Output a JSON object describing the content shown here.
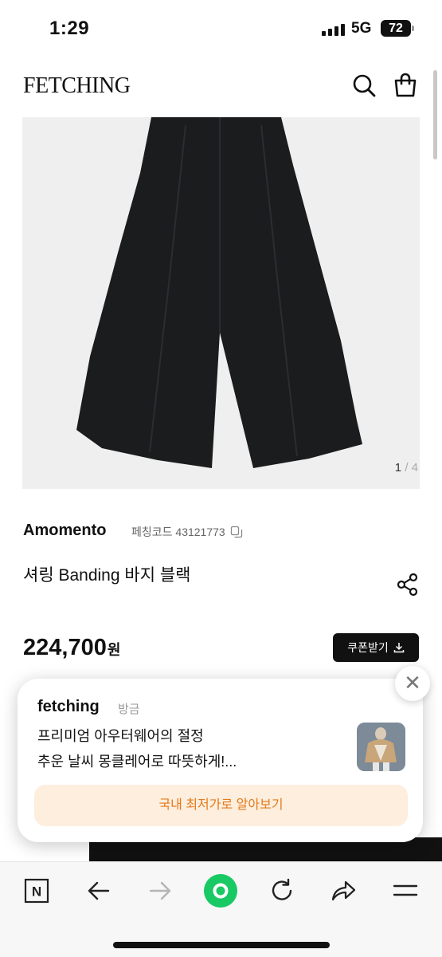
{
  "status_bar": {
    "time": "1:29",
    "network": "5G",
    "battery": "72"
  },
  "header": {
    "logo": "FETCHING",
    "icons": [
      "search-icon",
      "shopping-bag-icon"
    ]
  },
  "product": {
    "image_counter": {
      "current": "1",
      "separator": "/",
      "total": "4"
    },
    "brand": "Amomento",
    "code_label": "페칭코드 43121773",
    "title": "셔링 Banding 바지 블랙",
    "price": "224,700",
    "currency": "원",
    "coupon_label": "쿠폰받기"
  },
  "notification": {
    "app": "fetching",
    "time": "방금",
    "line1": "프리미엄 아우터웨어의 절정",
    "line2": "추운 날씨 몽클레어로 따뜻하게!...",
    "cta": "국내 최저가로 알아보기",
    "close_symbol": "✕"
  },
  "toolbar": {
    "icons": [
      "naver-n-icon",
      "back-arrow-icon",
      "forward-arrow-icon",
      "green-home-icon",
      "refresh-icon",
      "share-arrow-icon",
      "menu-icon"
    ],
    "n_label": "N"
  },
  "colors": {
    "accent_green": "#18c964",
    "cta_bg": "#fdeedd",
    "cta_text": "#e57a1a"
  }
}
